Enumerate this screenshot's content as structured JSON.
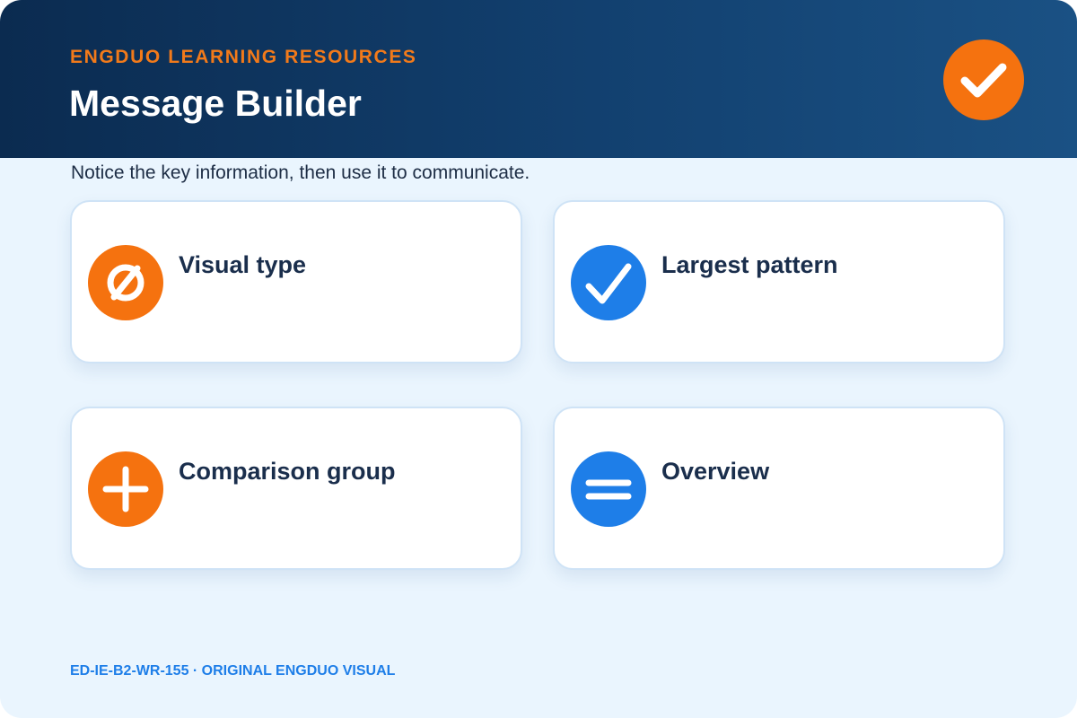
{
  "header": {
    "eyebrow": "ENGDUO LEARNING RESOURCES",
    "title": "Message Builder",
    "badge_icon": "checkmark-icon"
  },
  "subtitle": "Notice the key information, then use it to communicate.",
  "cards": [
    {
      "label": "Visual type",
      "icon": "slashed-circle-icon",
      "color": "#f5720f"
    },
    {
      "label": "Largest pattern",
      "icon": "checkmark-icon",
      "color": "#1e7ee8"
    },
    {
      "label": "Comparison group",
      "icon": "plus-icon",
      "color": "#f5720f"
    },
    {
      "label": "Overview",
      "icon": "equals-icon",
      "color": "#1e7ee8"
    }
  ],
  "footer": "ED-IE-B2-WR-155 · ORIGINAL ENGDUO VISUAL",
  "colors": {
    "header_dark": "#0b2b50",
    "header_light": "#1a5184",
    "accent_orange": "#f5720f",
    "accent_blue": "#1e7ee8",
    "page_background": "#eaf5fe"
  }
}
